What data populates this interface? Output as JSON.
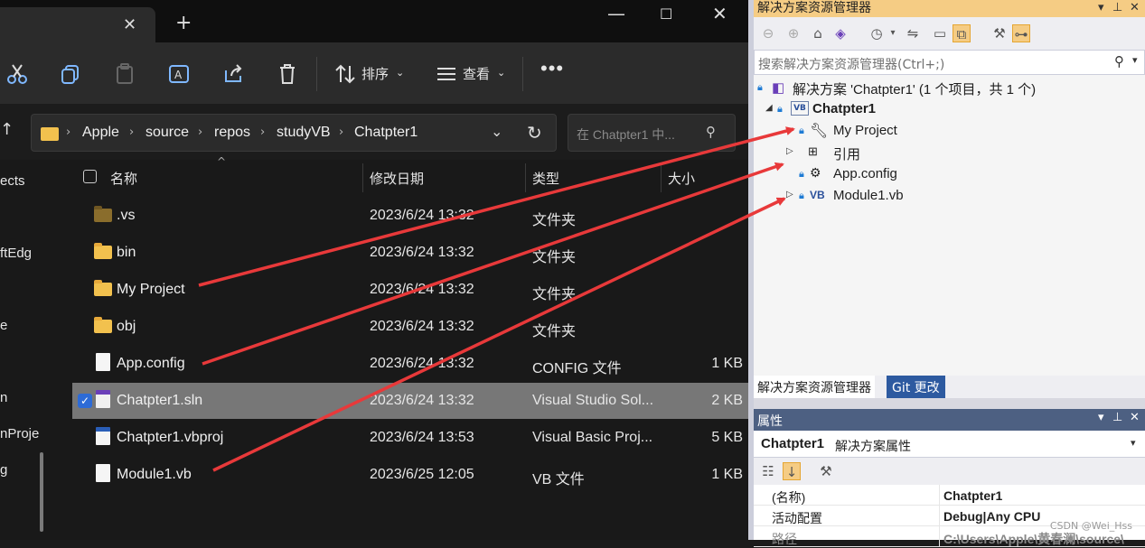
{
  "explorer": {
    "new_tab": "+",
    "commands": {
      "sort_label": "排序",
      "view_label": "查看"
    },
    "breadcrumb": [
      "Apple",
      "source",
      "repos",
      "studyVB",
      "Chatpter1"
    ],
    "search_placeholder": "在 Chatpter1 中...",
    "nav_items": [
      "ects",
      "ftEdg",
      "e",
      "n",
      "nProje",
      "g"
    ],
    "columns": {
      "name": "名称",
      "modified": "修改日期",
      "type": "类型",
      "size": "大小"
    },
    "files": [
      {
        "name": ".vs",
        "date": "2023/6/24 13:32",
        "type": "文件夹",
        "size": "",
        "icon": "folder-hidden"
      },
      {
        "name": "bin",
        "date": "2023/6/24 13:32",
        "type": "文件夹",
        "size": "",
        "icon": "folder"
      },
      {
        "name": "My Project",
        "date": "2023/6/24 13:32",
        "type": "文件夹",
        "size": "",
        "icon": "folder"
      },
      {
        "name": "obj",
        "date": "2023/6/24 13:32",
        "type": "文件夹",
        "size": "",
        "icon": "folder"
      },
      {
        "name": "App.config",
        "date": "2023/6/24 13:32",
        "type": "CONFIG 文件",
        "size": "1 KB",
        "icon": "file"
      },
      {
        "name": "Chatpter1.sln",
        "date": "2023/6/24 13:32",
        "type": "Visual Studio Sol...",
        "size": "2 KB",
        "icon": "sln",
        "selected": true
      },
      {
        "name": "Chatpter1.vbproj",
        "date": "2023/6/24 13:53",
        "type": "Visual Basic Proj...",
        "size": "5 KB",
        "icon": "vbproj"
      },
      {
        "name": "Module1.vb",
        "date": "2023/6/25 12:05",
        "type": "VB 文件",
        "size": "1 KB",
        "icon": "file"
      }
    ]
  },
  "vs": {
    "title": "解决方案资源管理器",
    "search_placeholder": "搜索解决方案资源管理器(Ctrl+;)",
    "solution_label": "解决方案 'Chatpter1' (1 个项目，共 1 个)",
    "project": "Chatpter1",
    "project_badge": "VB",
    "items": [
      "My Project",
      "引用",
      "App.config",
      "Module1.vb"
    ],
    "module_badge": "VB",
    "tab_solution": "解决方案资源管理器",
    "tab_git": "Git 更改",
    "properties_title": "属性",
    "prop_object": "Chatpter1",
    "prop_object_desc": "解决方案属性",
    "props": [
      {
        "key": "(名称)",
        "value": "Chatpter1"
      },
      {
        "key": "活动配置",
        "value": "Debug|Any CPU"
      },
      {
        "key": "路径",
        "value": "C:\\Users\\Apple\\黄春澜\\source\\"
      }
    ],
    "watermark": "CSDN @Wei_Hss"
  },
  "colors": {
    "arrow": "#e8393a",
    "vs_accent": "#f5cc84",
    "selection": "#777777"
  }
}
